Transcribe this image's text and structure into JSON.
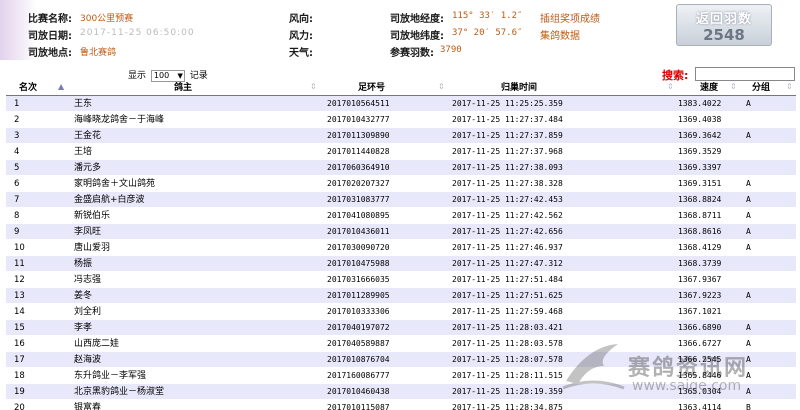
{
  "race": {
    "name_label": "比赛名称:",
    "name_value": "300公里预赛",
    "date_label": "司放日期:",
    "date_value": "2017-11-25 06:50:00",
    "club_label": "司放地点:",
    "club_value": "鲁北赛鸽",
    "wind_dir_label": "风向:",
    "wind_dir_value": "",
    "wind_force_label": "风力:",
    "wind_force_value": "",
    "weather_label": "天气:",
    "weather_value": "",
    "lon_label": "司放地经度:",
    "lon_value": "115° 33′ 1.2″",
    "lat_label": "司放地纬度:",
    "lat_value": "37° 20′ 57.6″",
    "count_label": "参赛羽数:",
    "count_value": "3790",
    "link_group_results": "插组奖项成绩",
    "link_group_data": "集鸽数据"
  },
  "back_box": {
    "label": "返回羽数",
    "value": "2548"
  },
  "controls": {
    "show_prefix": "显示",
    "show_value": "100",
    "show_suffix": "记录",
    "search_label": "搜索:",
    "search_value": ""
  },
  "table": {
    "headers": {
      "rank": "名次",
      "owner": "鸽主",
      "ring": "足环号",
      "time": "归巢时间",
      "speed": "速度",
      "group": "分组"
    },
    "rows": [
      {
        "rank": "1",
        "owner": "王东",
        "ring": "2017010564511",
        "time": "2017-11-25 11:25:25.359",
        "speed": "1383.4022",
        "group": "A"
      },
      {
        "rank": "2",
        "owner": "海峰晓龙鸽舍－于海峰",
        "ring": "2017010432777",
        "time": "2017-11-25 11:27:37.484",
        "speed": "1369.4038",
        "group": ""
      },
      {
        "rank": "3",
        "owner": "王金花",
        "ring": "2017011309890",
        "time": "2017-11-25 11:27:37.859",
        "speed": "1369.3642",
        "group": "A"
      },
      {
        "rank": "4",
        "owner": "王培",
        "ring": "2017011440828",
        "time": "2017-11-25 11:27:37.968",
        "speed": "1369.3529",
        "group": ""
      },
      {
        "rank": "5",
        "owner": "潘元多",
        "ring": "2017060364910",
        "time": "2017-11-25 11:27:38.093",
        "speed": "1369.3397",
        "group": ""
      },
      {
        "rank": "6",
        "owner": "家明鸽舍＋文山鸽苑",
        "ring": "2017020207327",
        "time": "2017-11-25 11:27:38.328",
        "speed": "1369.3151",
        "group": "A"
      },
      {
        "rank": "7",
        "owner": "金盛启航+白彦波",
        "ring": "2017031083777",
        "time": "2017-11-25 11:27:42.453",
        "speed": "1368.8824",
        "group": "A"
      },
      {
        "rank": "8",
        "owner": "新锐伯乐",
        "ring": "2017041080895",
        "time": "2017-11-25 11:27:42.562",
        "speed": "1368.8711",
        "group": "A"
      },
      {
        "rank": "9",
        "owner": "李凤旺",
        "ring": "2017010436011",
        "time": "2017-11-25 11:27:42.656",
        "speed": "1368.8616",
        "group": "A"
      },
      {
        "rank": "10",
        "owner": "唐山爱羽",
        "ring": "2017030090720",
        "time": "2017-11-25 11:27:46.937",
        "speed": "1368.4129",
        "group": "A"
      },
      {
        "rank": "11",
        "owner": "杨振",
        "ring": "2017010475988",
        "time": "2017-11-25 11:27:47.312",
        "speed": "1368.3739",
        "group": ""
      },
      {
        "rank": "12",
        "owner": "冯志强",
        "ring": "2017031666035",
        "time": "2017-11-25 11:27:51.484",
        "speed": "1367.9367",
        "group": ""
      },
      {
        "rank": "13",
        "owner": "姜冬",
        "ring": "2017011289905",
        "time": "2017-11-25 11:27:51.625",
        "speed": "1367.9223",
        "group": "A"
      },
      {
        "rank": "14",
        "owner": "刘全利",
        "ring": "2017010333306",
        "time": "2017-11-25 11:27:59.468",
        "speed": "1367.1021",
        "group": ""
      },
      {
        "rank": "15",
        "owner": "李孝",
        "ring": "2017040197072",
        "time": "2017-11-25 11:28:03.421",
        "speed": "1366.6890",
        "group": "A"
      },
      {
        "rank": "16",
        "owner": "山西庞二娃",
        "ring": "2017040589887",
        "time": "2017-11-25 11:28:03.578",
        "speed": "1366.6727",
        "group": "A"
      },
      {
        "rank": "17",
        "owner": "赵海波",
        "ring": "2017010876704",
        "time": "2017-11-25 11:28:07.578",
        "speed": "1366.2545",
        "group": "A"
      },
      {
        "rank": "18",
        "owner": "东升鸽业－李军强",
        "ring": "2017160086777",
        "time": "2017-11-25 11:28:11.515",
        "speed": "1365.8446",
        "group": "A"
      },
      {
        "rank": "19",
        "owner": "北京黑豹鸽业－杨淑堂",
        "ring": "2017010460438",
        "time": "2017-11-25 11:28:19.359",
        "speed": "1365.0304",
        "group": "A"
      },
      {
        "rank": "20",
        "owner": "银富春",
        "ring": "2017010115087",
        "time": "2017-11-25 11:28:34.875",
        "speed": "1363.4114",
        "group": "B"
      }
    ]
  },
  "watermark": {
    "text_cn": "赛鸽资讯网",
    "text_url": "www.saige.com"
  },
  "colors": {
    "row_alt": "#e8e8fb",
    "accent": "#c05a12",
    "search_red": "#dd0000"
  }
}
